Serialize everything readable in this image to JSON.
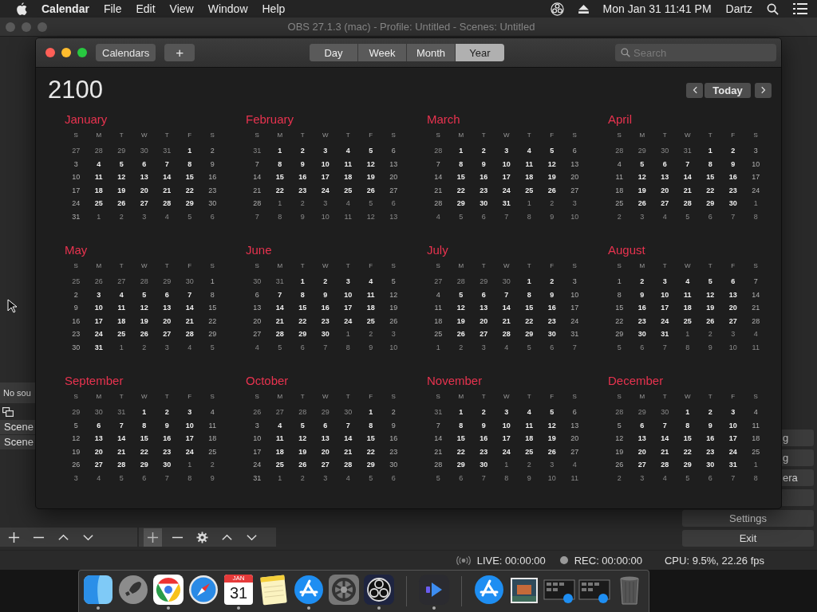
{
  "menu_bar": {
    "app": "Calendar",
    "menus": [
      "File",
      "Edit",
      "View",
      "Window",
      "Help"
    ],
    "clock": "Mon Jan 31  11:41 PM",
    "user": "Dartz"
  },
  "background_window": {
    "title": "OBS 27.1.3 (mac) - Profile: Untitled - Scenes: Untitled",
    "sources_text": "No sou",
    "scenes": [
      "Scene",
      "Scene"
    ],
    "buttons": [
      {
        "label": "g",
        "cut": true
      },
      {
        "label": "g",
        "cut": true
      },
      {
        "label": "era",
        "cut": true
      },
      {
        "cut": true
      },
      {
        "label": "Settings",
        "cut": false
      },
      {
        "label": "Exit",
        "cut": false
      }
    ],
    "status": {
      "live": "LIVE: 00:00:00",
      "rec": "REC: 00:00:00",
      "cpu": "CPU: 9.5%, 22.26 fps"
    }
  },
  "calendar": {
    "calendars_button": "Calendars",
    "add_button": "+",
    "views": [
      {
        "label": "Day",
        "selected": false
      },
      {
        "label": "Week",
        "selected": false
      },
      {
        "label": "Month",
        "selected": false
      },
      {
        "label": "Year",
        "selected": true
      }
    ],
    "search": {
      "placeholder": "Search"
    },
    "year": "2100",
    "today_button": "Today",
    "months": [
      {
        "name": "January",
        "weekdays": [
          "S",
          "M",
          "T",
          "W",
          "T",
          "F",
          "S"
        ],
        "prev_days": [
          "27",
          "28",
          "29",
          "30",
          "31"
        ],
        "days": [
          "1",
          "2",
          "3",
          "4",
          "5",
          "6",
          "7",
          "8",
          "9",
          "10",
          "11",
          "12",
          "13",
          "14",
          "15",
          "16",
          "17",
          "18",
          "19",
          "20",
          "21",
          "22",
          "23",
          "24",
          "25",
          "26",
          "27",
          "28",
          "29",
          "30",
          "31"
        ],
        "next_days": [
          "1",
          "2",
          "3",
          "4",
          "5",
          "6"
        ]
      },
      {
        "name": "February",
        "weekdays": [
          "S",
          "M",
          "T",
          "W",
          "T",
          "F",
          "S"
        ],
        "prev_days": [
          "31"
        ],
        "days": [
          "1",
          "2",
          "3",
          "4",
          "5",
          "6",
          "7",
          "8",
          "9",
          "10",
          "11",
          "12",
          "13",
          "14",
          "15",
          "16",
          "17",
          "18",
          "19",
          "20",
          "21",
          "22",
          "23",
          "24",
          "25",
          "26",
          "27",
          "28"
        ],
        "next_days": [
          "1",
          "2",
          "3",
          "4",
          "5",
          "6",
          "7",
          "8",
          "9",
          "10",
          "11",
          "12",
          "13"
        ]
      },
      {
        "name": "March",
        "weekdays": [
          "S",
          "M",
          "T",
          "W",
          "T",
          "F",
          "S"
        ],
        "prev_days": [
          "28"
        ],
        "days": [
          "1",
          "2",
          "3",
          "4",
          "5",
          "6",
          "7",
          "8",
          "9",
          "10",
          "11",
          "12",
          "13",
          "14",
          "15",
          "16",
          "17",
          "18",
          "19",
          "20",
          "21",
          "22",
          "23",
          "24",
          "25",
          "26",
          "27",
          "28",
          "29",
          "30",
          "31"
        ],
        "next_days": [
          "1",
          "2",
          "3",
          "4",
          "5",
          "6",
          "7",
          "8",
          "9",
          "10"
        ]
      },
      {
        "name": "April",
        "weekdays": [
          "S",
          "M",
          "T",
          "W",
          "T",
          "F",
          "S"
        ],
        "prev_days": [
          "28",
          "29",
          "30",
          "31"
        ],
        "days": [
          "1",
          "2",
          "3",
          "4",
          "5",
          "6",
          "7",
          "8",
          "9",
          "10",
          "11",
          "12",
          "13",
          "14",
          "15",
          "16",
          "17",
          "18",
          "19",
          "20",
          "21",
          "22",
          "23",
          "24",
          "25",
          "26",
          "27",
          "28",
          "29",
          "30"
        ],
        "next_days": [
          "1",
          "2",
          "3",
          "4",
          "5",
          "6",
          "7",
          "8"
        ]
      },
      {
        "name": "May",
        "weekdays": [
          "S",
          "M",
          "T",
          "W",
          "T",
          "F",
          "S"
        ],
        "prev_days": [
          "25",
          "26",
          "27",
          "28",
          "29",
          "30"
        ],
        "days": [
          "1",
          "2",
          "3",
          "4",
          "5",
          "6",
          "7",
          "8",
          "9",
          "10",
          "11",
          "12",
          "13",
          "14",
          "15",
          "16",
          "17",
          "18",
          "19",
          "20",
          "21",
          "22",
          "23",
          "24",
          "25",
          "26",
          "27",
          "28",
          "29",
          "30",
          "31"
        ],
        "next_days": [
          "1",
          "2",
          "3",
          "4",
          "5"
        ]
      },
      {
        "name": "June",
        "weekdays": [
          "S",
          "M",
          "T",
          "W",
          "T",
          "F",
          "S"
        ],
        "prev_days": [
          "30",
          "31"
        ],
        "days": [
          "1",
          "2",
          "3",
          "4",
          "5",
          "6",
          "7",
          "8",
          "9",
          "10",
          "11",
          "12",
          "13",
          "14",
          "15",
          "16",
          "17",
          "18",
          "19",
          "20",
          "21",
          "22",
          "23",
          "24",
          "25",
          "26",
          "27",
          "28",
          "29",
          "30"
        ],
        "next_days": [
          "1",
          "2",
          "3",
          "4",
          "5",
          "6",
          "7",
          "8",
          "9",
          "10"
        ]
      },
      {
        "name": "July",
        "weekdays": [
          "S",
          "M",
          "T",
          "W",
          "T",
          "F",
          "S"
        ],
        "prev_days": [
          "27",
          "28",
          "29",
          "30"
        ],
        "days": [
          "1",
          "2",
          "3",
          "4",
          "5",
          "6",
          "7",
          "8",
          "9",
          "10",
          "11",
          "12",
          "13",
          "14",
          "15",
          "16",
          "17",
          "18",
          "19",
          "20",
          "21",
          "22",
          "23",
          "24",
          "25",
          "26",
          "27",
          "28",
          "29",
          "30",
          "31"
        ],
        "next_days": [
          "1",
          "2",
          "3",
          "4",
          "5",
          "6",
          "7"
        ]
      },
      {
        "name": "August",
        "weekdays": [
          "S",
          "M",
          "T",
          "W",
          "T",
          "F",
          "S"
        ],
        "days": [
          "1",
          "2",
          "3",
          "4",
          "5",
          "6",
          "7",
          "8",
          "9",
          "10",
          "11",
          "12",
          "13",
          "14",
          "15",
          "16",
          "17",
          "18",
          "19",
          "20",
          "21",
          "22",
          "23",
          "24",
          "25",
          "26",
          "27",
          "28",
          "29",
          "30",
          "31"
        ],
        "next_days": [
          "1",
          "2",
          "3",
          "4",
          "5",
          "6",
          "7",
          "8",
          "9",
          "10",
          "11"
        ]
      },
      {
        "name": "September",
        "weekdays": [
          "S",
          "M",
          "T",
          "W",
          "T",
          "F",
          "S"
        ],
        "prev_days": [
          "29",
          "30",
          "31"
        ],
        "days": [
          "1",
          "2",
          "3",
          "4",
          "5",
          "6",
          "7",
          "8",
          "9",
          "10",
          "11",
          "12",
          "13",
          "14",
          "15",
          "16",
          "17",
          "18",
          "19",
          "20",
          "21",
          "22",
          "23",
          "24",
          "25",
          "26",
          "27",
          "28",
          "29",
          "30"
        ],
        "next_days": [
          "1",
          "2",
          "3",
          "4",
          "5",
          "6",
          "7",
          "8",
          "9"
        ]
      },
      {
        "name": "October",
        "weekdays": [
          "S",
          "M",
          "T",
          "W",
          "T",
          "F",
          "S"
        ],
        "prev_days": [
          "26",
          "27",
          "28",
          "29",
          "30"
        ],
        "days": [
          "1",
          "2",
          "3",
          "4",
          "5",
          "6",
          "7",
          "8",
          "9",
          "10",
          "11",
          "12",
          "13",
          "14",
          "15",
          "16",
          "17",
          "18",
          "19",
          "20",
          "21",
          "22",
          "23",
          "24",
          "25",
          "26",
          "27",
          "28",
          "29",
          "30",
          "31"
        ],
        "next_days": [
          "1",
          "2",
          "3",
          "4",
          "5",
          "6"
        ]
      },
      {
        "name": "November",
        "weekdays": [
          "S",
          "M",
          "T",
          "W",
          "T",
          "F",
          "S"
        ],
        "prev_days": [
          "31"
        ],
        "days": [
          "1",
          "2",
          "3",
          "4",
          "5",
          "6",
          "7",
          "8",
          "9",
          "10",
          "11",
          "12",
          "13",
          "14",
          "15",
          "16",
          "17",
          "18",
          "19",
          "20",
          "21",
          "22",
          "23",
          "24",
          "25",
          "26",
          "27",
          "28",
          "29",
          "30"
        ],
        "next_days": [
          "1",
          "2",
          "3",
          "4",
          "5",
          "6",
          "7",
          "8",
          "9",
          "10",
          "11"
        ]
      },
      {
        "name": "December",
        "weekdays": [
          "S",
          "M",
          "T",
          "W",
          "T",
          "F",
          "S"
        ],
        "prev_days": [
          "28",
          "29",
          "30"
        ],
        "days": [
          "1",
          "2",
          "3",
          "4",
          "5",
          "6",
          "7",
          "8",
          "9",
          "10",
          "11",
          "12",
          "13",
          "14",
          "15",
          "16",
          "17",
          "18",
          "19",
          "20",
          "21",
          "22",
          "23",
          "24",
          "25",
          "26",
          "27",
          "28",
          "29",
          "30",
          "31"
        ],
        "next_days": [
          "1",
          "2",
          "3",
          "4",
          "5",
          "6",
          "7",
          "8"
        ]
      }
    ]
  },
  "dock": [
    {
      "kind": "finder",
      "running": true
    },
    {
      "kind": "launchpad",
      "running": false
    },
    {
      "kind": "chrome",
      "running": true
    },
    {
      "kind": "safari",
      "running": false
    },
    {
      "kind": "calendar",
      "running": true,
      "month": "JAN",
      "day": "31"
    },
    {
      "kind": "notes",
      "running": false
    },
    {
      "kind": "appstore",
      "running": true
    },
    {
      "kind": "preferences",
      "running": false
    },
    {
      "kind": "obs",
      "running": true
    },
    {
      "kind": "separator"
    },
    {
      "kind": "player",
      "running": true
    },
    {
      "kind": "separator"
    },
    {
      "kind": "downloads",
      "running": false
    },
    {
      "kind": "photo",
      "running": false
    },
    {
      "kind": "screenshot",
      "running": false
    },
    {
      "kind": "screenshot",
      "running": false
    },
    {
      "kind": "trash",
      "running": false
    }
  ]
}
